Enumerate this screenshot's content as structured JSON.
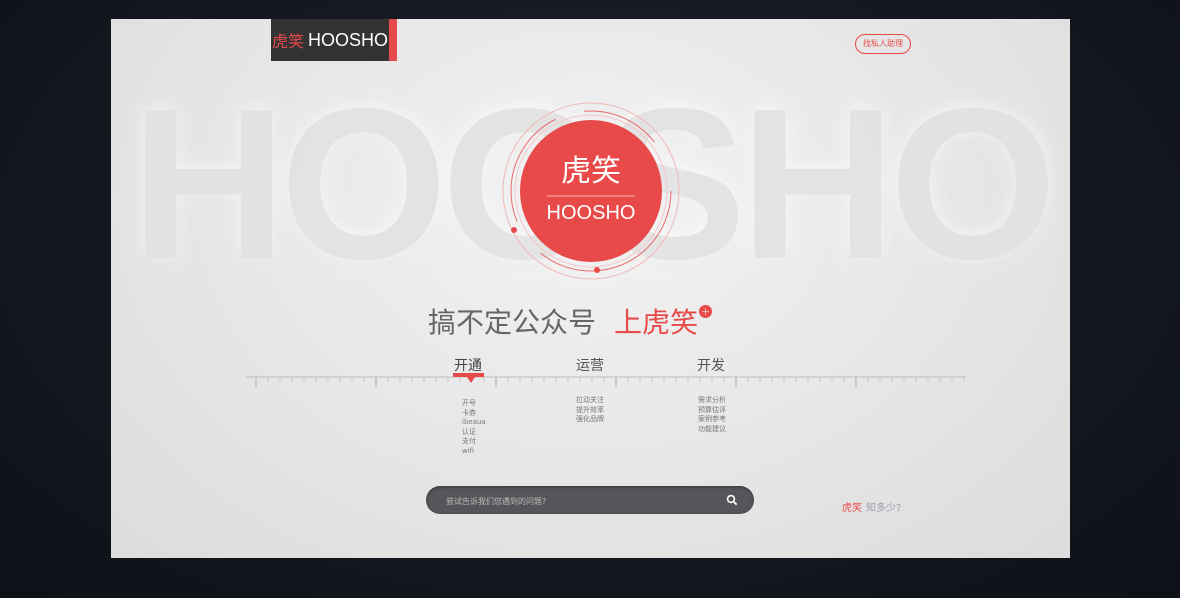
{
  "logo": {
    "cn": "虎笑",
    "en": "HOOSHO"
  },
  "background_word": "HOOSHO",
  "help_button": "找私人助理",
  "center_badge": {
    "cn": "虎笑",
    "en": "HOOSHO"
  },
  "slogan": {
    "main": "搞不定公众号",
    "highlight": "上虎笑",
    "plus": "+"
  },
  "timeline": {
    "stages": [
      {
        "label": "开通",
        "active": true,
        "items": [
          "开号",
          "卡券",
          "ibeaua",
          "认证",
          "支付",
          "wifi"
        ]
      },
      {
        "label": "运营",
        "active": false,
        "items": [
          "拉动关注",
          "提升效率",
          "强化品牌"
        ]
      },
      {
        "label": "开发",
        "active": false,
        "items": [
          "需求分析",
          "预算估评",
          "案例参考",
          "功能建议"
        ]
      }
    ]
  },
  "search": {
    "placeholder": "尝试告诉我们您遇到的问题?"
  },
  "know_more": {
    "brand": "虎笑",
    "text": "知多少?"
  },
  "colors": {
    "accent": "#e84a4a",
    "dark": "#333333",
    "search_bg": "#555659"
  }
}
